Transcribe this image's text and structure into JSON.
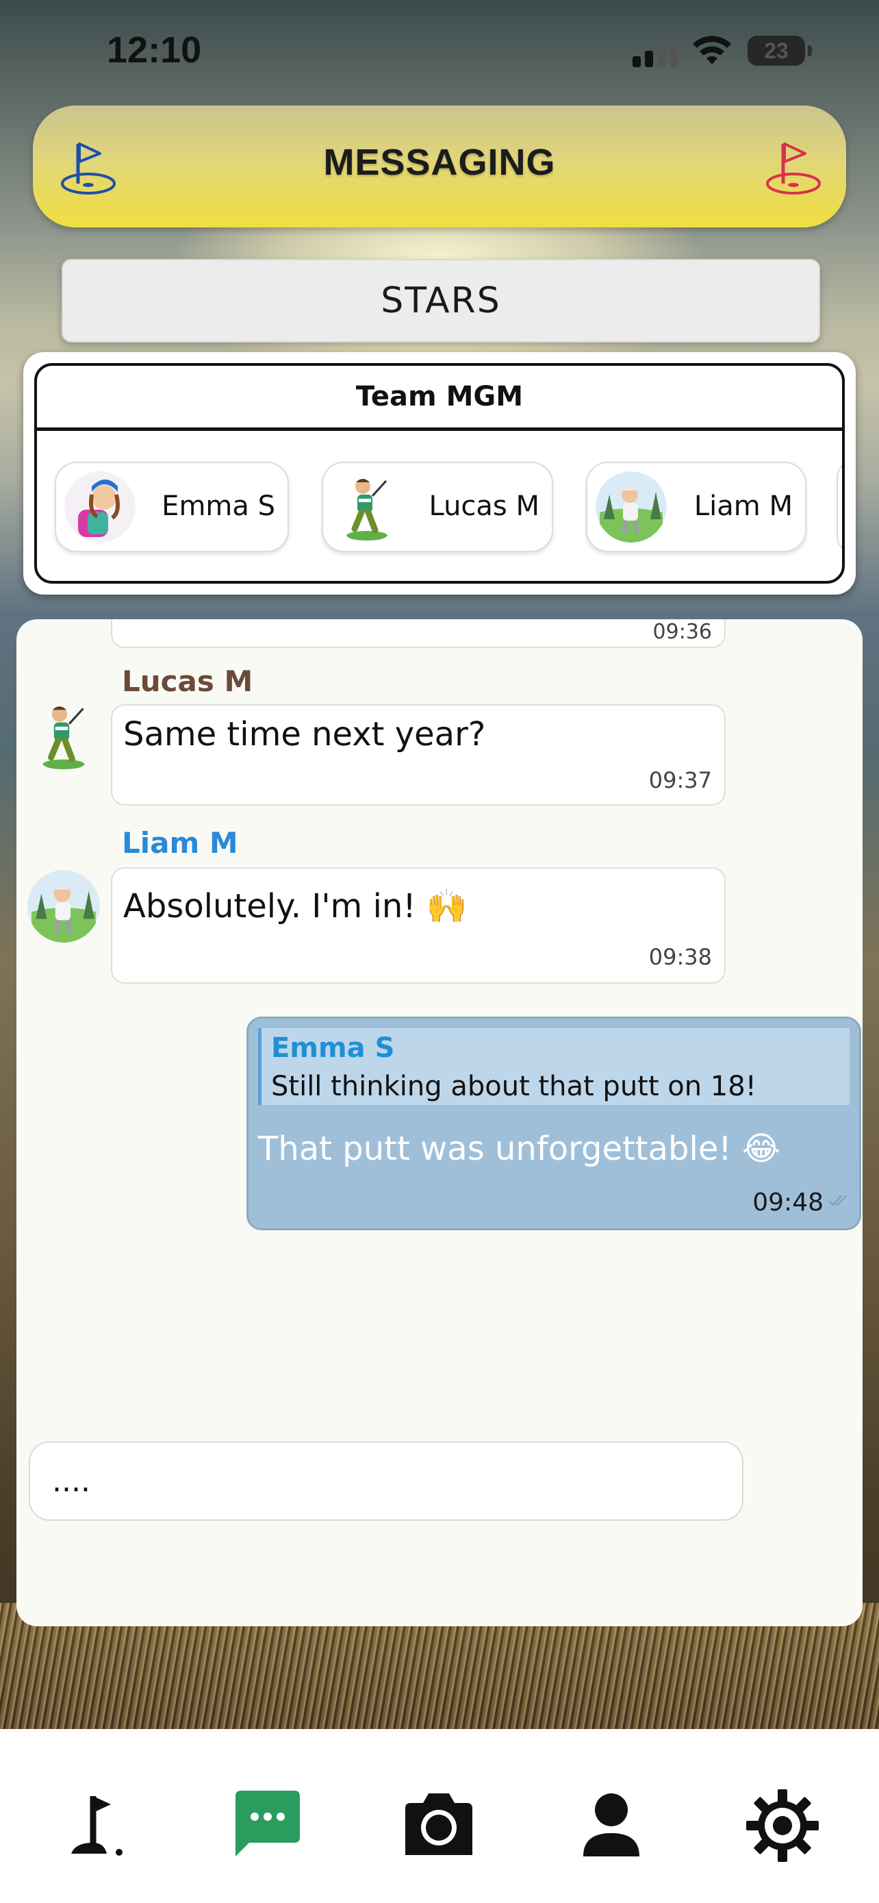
{
  "status_bar": {
    "time": "12:10",
    "battery": "23"
  },
  "header": {
    "title": "MESSAGING",
    "left_icon": "golf-flag-icon",
    "right_icon": "golf-flag-icon"
  },
  "stars_button": {
    "label": "STARS"
  },
  "team": {
    "name": "Team MGM",
    "members": [
      {
        "name": "Emma S",
        "avatar": "avatar-emma"
      },
      {
        "name": "Lucas M",
        "avatar": "avatar-lucas"
      },
      {
        "name": "Liam M",
        "avatar": "avatar-liam"
      }
    ]
  },
  "chat": {
    "partial_message": {
      "timestamp": "09:36"
    },
    "messages": [
      {
        "sender": "Lucas M",
        "sender_color": "#6b4a3a",
        "text": "Same time next year?",
        "timestamp": "09:37"
      },
      {
        "sender": "Liam M",
        "sender_color": "#2a8ad8",
        "text": "Absolutely. I'm in! 🙌",
        "timestamp": "09:38"
      }
    ],
    "outgoing": {
      "reply_to_sender": "Emma S",
      "reply_to_text": "Still thinking about that putt on 18!",
      "text": "That putt was unforgettable! 😂",
      "timestamp": "09:48"
    },
    "input": {
      "value": "...."
    }
  },
  "tabbar": {
    "tabs": [
      {
        "icon": "golf-flag-icon"
      },
      {
        "icon": "chat-icon",
        "active": true,
        "color": "#2a9d5e"
      },
      {
        "icon": "camera-icon"
      },
      {
        "icon": "person-icon"
      },
      {
        "icon": "gear-icon"
      }
    ]
  }
}
